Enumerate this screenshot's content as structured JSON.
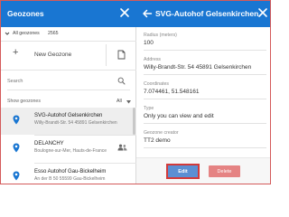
{
  "left_panel": {
    "title": "Geozones",
    "filter": {
      "label": "All geozones",
      "count": "2565"
    },
    "new_label": "New Geozone",
    "search": {
      "placeholder": "Search"
    },
    "show": {
      "label": "Show geozones",
      "value": "All"
    },
    "items": [
      {
        "name": "SVG-Autohof Gelsenkirchen",
        "address": "Willy-Brandt-Str. 54 45891 Gelsenkirchen",
        "selected": true
      },
      {
        "name": "DELANCHY",
        "address": "Boulogne-sur-Mer, Hauts-de-France",
        "selected": false
      },
      {
        "name": "Esso Autohof Gau-Bickelheim",
        "address": "An der B 50 55599 Gau-Bickelheim",
        "selected": false
      }
    ]
  },
  "right_panel": {
    "title": "SVG-Autohof Gelsenkirchen",
    "fields": [
      {
        "label": "Radius (meters)",
        "value": "100"
      },
      {
        "label": "Address",
        "value": "Willy-Brandt-Str. 54 45891 Gelsenkirchen"
      },
      {
        "label": "Coordinates",
        "value": "7.074461, 51.548161"
      },
      {
        "label": "Type",
        "value": "Only you can view and edit"
      },
      {
        "label": "Geozone creator",
        "value": "TT2 demo"
      }
    ],
    "edit_label": "Edit",
    "delete_label": "Delete"
  },
  "colors": {
    "header": "#1976d2",
    "edit_button": "#5b8fd3",
    "delete_button": "#e58383",
    "highlight_border": "#d23a3a",
    "pin": "#1976d2"
  },
  "icons": [
    "close-icon",
    "chevron-down-icon",
    "plus-icon",
    "document-icon",
    "search-icon",
    "location-pin-icon",
    "people-icon",
    "back-arrow-icon"
  ]
}
